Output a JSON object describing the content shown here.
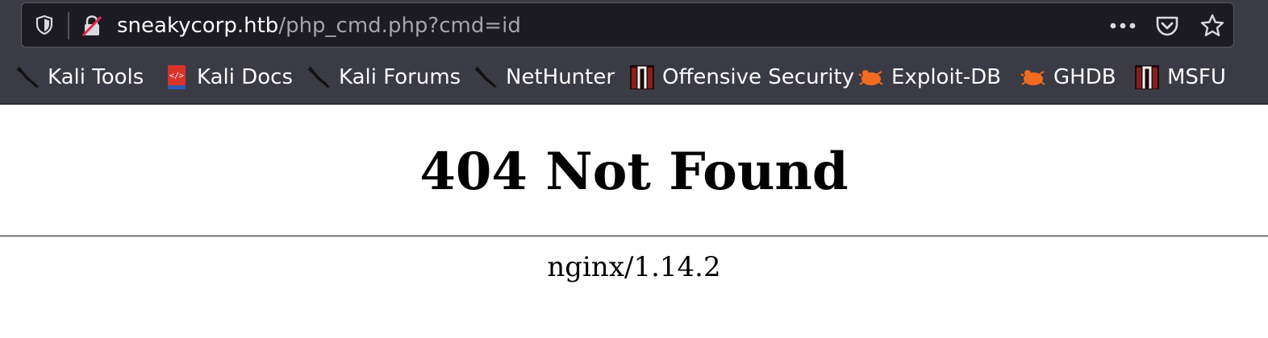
{
  "browser": {
    "url_host": "sneakycorp.htb",
    "url_path": "/php_cmd.php?cmd=id",
    "bookmarks": [
      {
        "label": "Kali Tools",
        "icon": "kali-dragon-icon"
      },
      {
        "label": "Kali Docs",
        "icon": "kali-docs-icon"
      },
      {
        "label": "Kali Forums",
        "icon": "kali-dragon-icon"
      },
      {
        "label": "NetHunter",
        "icon": "kali-dragon-icon"
      },
      {
        "label": "Offensive Security",
        "icon": "offsec-icon"
      },
      {
        "label": "Exploit-DB",
        "icon": "exploit-db-icon"
      },
      {
        "label": "GHDB",
        "icon": "exploit-db-icon"
      },
      {
        "label": "MSFU",
        "icon": "offsec-icon"
      }
    ]
  },
  "page": {
    "title": "404 Not Found",
    "server": "nginx/1.14.2"
  },
  "colors": {
    "toolbar": "#3b3b45",
    "urlbar": "#1c1b22",
    "text_light": "#fbfbfe",
    "text_dim": "#a4a4ae",
    "insecure_strike": "#e22850",
    "exploit_orange": "#f26b21"
  }
}
